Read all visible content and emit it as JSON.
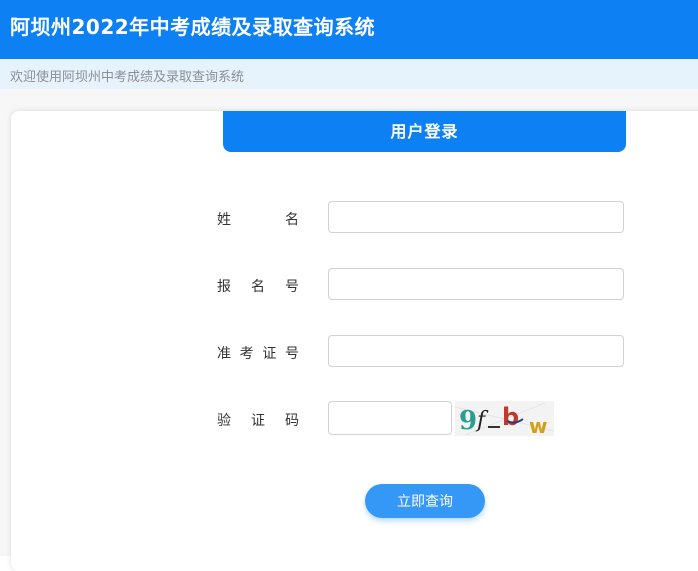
{
  "header": {
    "title": "阿坝州2022年中考成绩及录取查询系统",
    "color": "#0d80f4"
  },
  "subbar": {
    "text": "欢迎使用阿坝州中考成绩及录取查询系统"
  },
  "login": {
    "tab_title": "用户登录",
    "fields": [
      {
        "chars": [
          "姓",
          "名"
        ],
        "value": ""
      },
      {
        "chars": [
          "报",
          "名",
          "号"
        ],
        "value": ""
      },
      {
        "chars": [
          "准",
          "考",
          "证",
          "号"
        ],
        "value": ""
      }
    ],
    "captcha": {
      "chars": [
        "验",
        "证",
        "码"
      ],
      "value": "",
      "image_text": "9f_bw"
    },
    "submit_label": "立即查询"
  }
}
